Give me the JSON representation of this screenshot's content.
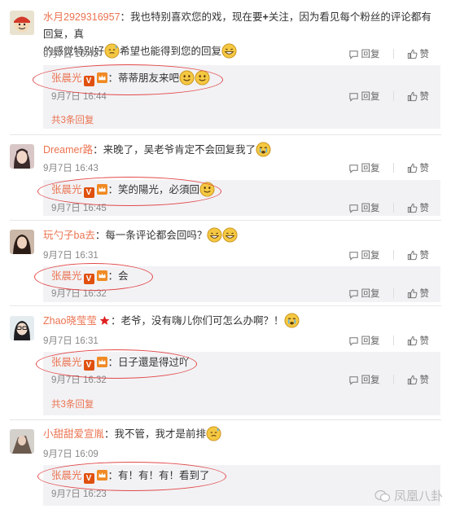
{
  "actions": {
    "reply": "回复",
    "like": "赞"
  },
  "comments": [
    {
      "user": "水月2929316957",
      "text_a": "：我也特别喜欢您的戏，现在要",
      "plus": "+",
      "text_b": "关注，因为看见每个粉丝的评论都有回复，真",
      "text_c": "的感觉特别好",
      "text_d": "希望也能得到您的回复",
      "time": "9月7日 16:43",
      "reply": {
        "user": "张晨光",
        "text": "：蒂蒂朋友来吧",
        "time": "9月7日 16:44"
      },
      "more": "共3条回复"
    },
    {
      "user": "Dreamer路",
      "text_a": "：来晚了，吴老爷肯定不会回复我了",
      "time": "9月7日 16:43",
      "reply": {
        "user": "张晨光",
        "text": "：笑的陽光，必須回",
        "time": "9月7日 16:45"
      }
    },
    {
      "user": "玩勺子ba去",
      "text_a": "：每一条评论都会回吗？",
      "time": "9月7日 16:31",
      "reply": {
        "user": "张晨光",
        "text": "：会",
        "time": "9月7日 16:32"
      }
    },
    {
      "user": "Zhao晓莹莹",
      "text_a": "：老爷，没有嗨儿你们可怎么办啊？！",
      "time": "9月7日 16:31",
      "reply": {
        "user": "张晨光",
        "text": "：日子還是得过吖",
        "time": "9月7日 16:32"
      },
      "more": "共3条回复"
    },
    {
      "user": "小甜甜爱宣胤",
      "text_a": "：我不管，我才是前排",
      "time": "9月7日 16:09",
      "reply": {
        "user": "张晨光",
        "text": "：有！有！有！看到了",
        "time": "9月7日 16:23"
      }
    }
  ],
  "watermark": "凤凰八卦",
  "colors": {
    "link": "#eb7350",
    "oval": "#e24a4a",
    "reply_bg": "#f2f2f5"
  }
}
